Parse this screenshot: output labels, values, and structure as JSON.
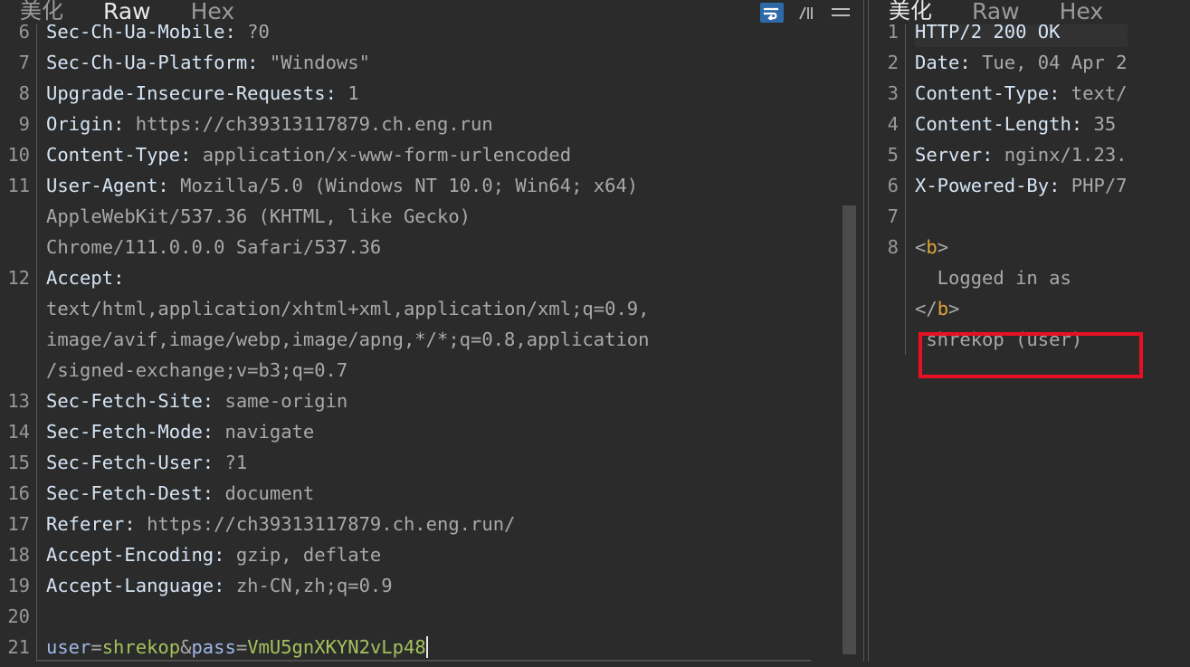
{
  "request_panel": {
    "tabs": [
      {
        "label": "美化",
        "active": false,
        "cjk": true
      },
      {
        "label": "Raw",
        "active": true,
        "cjk": false
      },
      {
        "label": "Hex",
        "active": false,
        "cjk": false
      }
    ],
    "icons": [
      {
        "name": "word-wrap-icon",
        "selected": true
      },
      {
        "name": "newline-escape-icon",
        "selected": false
      },
      {
        "name": "hamburger-menu-icon",
        "selected": false
      }
    ],
    "lines": [
      {
        "num": "6",
        "segments": [
          {
            "t": "Sec-Ch-Ua-Mobile",
            "c": "hdr"
          },
          {
            "t": ": ",
            "c": "hdr"
          },
          {
            "t": "?0",
            "c": "val"
          }
        ],
        "clipped_top": true
      },
      {
        "num": "7",
        "segments": [
          {
            "t": "Sec-Ch-Ua-Platform",
            "c": "hdr"
          },
          {
            "t": ": ",
            "c": "hdr"
          },
          {
            "t": "\"Windows\"",
            "c": "val"
          }
        ]
      },
      {
        "num": "8",
        "segments": [
          {
            "t": "Upgrade-Insecure-Requests",
            "c": "hdr"
          },
          {
            "t": ": ",
            "c": "hdr"
          },
          {
            "t": "1",
            "c": "val"
          }
        ]
      },
      {
        "num": "9",
        "segments": [
          {
            "t": "Origin",
            "c": "hdr"
          },
          {
            "t": ": ",
            "c": "hdr"
          },
          {
            "t": "https://ch39313117879.ch.eng.run",
            "c": "val"
          }
        ]
      },
      {
        "num": "10",
        "segments": [
          {
            "t": "Content-Type",
            "c": "hdr"
          },
          {
            "t": ": ",
            "c": "hdr"
          },
          {
            "t": "application/x-www-form-urlencoded",
            "c": "val"
          }
        ]
      },
      {
        "num": "11",
        "segments": [
          {
            "t": "User-Agent",
            "c": "hdr"
          },
          {
            "t": ": ",
            "c": "hdr"
          },
          {
            "t": "Mozilla/5.0 (Windows NT 10.0; Win64; x64)",
            "c": "val"
          }
        ]
      },
      {
        "num": "",
        "segments": [
          {
            "t": "AppleWebKit/537.36 (KHTML, like Gecko)",
            "c": "val"
          }
        ]
      },
      {
        "num": "",
        "segments": [
          {
            "t": "Chrome/111.0.0.0 Safari/537.36",
            "c": "val"
          }
        ]
      },
      {
        "num": "12",
        "segments": [
          {
            "t": "Accept",
            "c": "hdr"
          },
          {
            "t": ":",
            "c": "hdr"
          }
        ]
      },
      {
        "num": "",
        "segments": [
          {
            "t": "text/html,application/xhtml+xml,application/xml;q=0.9,",
            "c": "val"
          }
        ]
      },
      {
        "num": "",
        "segments": [
          {
            "t": "image/avif,image/webp,image/apng,*/*;q=0.8,application",
            "c": "val"
          }
        ]
      },
      {
        "num": "",
        "segments": [
          {
            "t": "/signed-exchange;v=b3;q=0.7",
            "c": "val"
          }
        ]
      },
      {
        "num": "13",
        "segments": [
          {
            "t": "Sec-Fetch-Site",
            "c": "hdr"
          },
          {
            "t": ": ",
            "c": "hdr"
          },
          {
            "t": "same-origin",
            "c": "val"
          }
        ]
      },
      {
        "num": "14",
        "segments": [
          {
            "t": "Sec-Fetch-Mode",
            "c": "hdr"
          },
          {
            "t": ": ",
            "c": "hdr"
          },
          {
            "t": "navigate",
            "c": "val"
          }
        ]
      },
      {
        "num": "15",
        "segments": [
          {
            "t": "Sec-Fetch-User",
            "c": "hdr"
          },
          {
            "t": ": ",
            "c": "hdr"
          },
          {
            "t": "?1",
            "c": "val"
          }
        ]
      },
      {
        "num": "16",
        "segments": [
          {
            "t": "Sec-Fetch-Dest",
            "c": "hdr"
          },
          {
            "t": ": ",
            "c": "hdr"
          },
          {
            "t": "document",
            "c": "val"
          }
        ]
      },
      {
        "num": "17",
        "segments": [
          {
            "t": "Referer",
            "c": "hdr"
          },
          {
            "t": ": ",
            "c": "hdr"
          },
          {
            "t": "https://ch39313117879.ch.eng.run/",
            "c": "val"
          }
        ]
      },
      {
        "num": "18",
        "segments": [
          {
            "t": "Accept-Encoding",
            "c": "hdr"
          },
          {
            "t": ": ",
            "c": "hdr"
          },
          {
            "t": "gzip, deflate",
            "c": "val"
          }
        ]
      },
      {
        "num": "19",
        "segments": [
          {
            "t": "Accept-Language",
            "c": "hdr"
          },
          {
            "t": ": ",
            "c": "hdr"
          },
          {
            "t": "zh-CN,zh;q=0.9",
            "c": "val"
          }
        ]
      },
      {
        "num": "20",
        "segments": []
      },
      {
        "num": "21",
        "segments": [
          {
            "t": "user",
            "c": "key"
          },
          {
            "t": "=",
            "c": "val"
          },
          {
            "t": "shrekop",
            "c": "str"
          },
          {
            "t": "&",
            "c": "val"
          },
          {
            "t": "pass",
            "c": "key"
          },
          {
            "t": "=",
            "c": "val"
          },
          {
            "t": "VmU5gnXKYN2vLp48",
            "c": "str"
          }
        ],
        "caret": true
      }
    ]
  },
  "response_panel": {
    "tabs": [
      {
        "label": "美化",
        "active": true,
        "cjk": true
      },
      {
        "label": "Raw",
        "active": false,
        "cjk": false
      },
      {
        "label": "Hex",
        "active": false,
        "cjk": false
      }
    ],
    "lines": [
      {
        "num": "1",
        "segments": [
          {
            "t": "HTTP/2 200 OK",
            "c": "hdr"
          }
        ],
        "current": true
      },
      {
        "num": "2",
        "segments": [
          {
            "t": "Date",
            "c": "hdr"
          },
          {
            "t": ": ",
            "c": "hdr"
          },
          {
            "t": "Tue, 04 Apr 2",
            "c": "val"
          }
        ]
      },
      {
        "num": "3",
        "segments": [
          {
            "t": "Content-Type",
            "c": "hdr"
          },
          {
            "t": ": ",
            "c": "hdr"
          },
          {
            "t": "text/",
            "c": "val"
          }
        ]
      },
      {
        "num": "4",
        "segments": [
          {
            "t": "Content-Length",
            "c": "hdr"
          },
          {
            "t": ": ",
            "c": "hdr"
          },
          {
            "t": "35",
            "c": "val"
          }
        ]
      },
      {
        "num": "5",
        "segments": [
          {
            "t": "Server",
            "c": "hdr"
          },
          {
            "t": ": ",
            "c": "hdr"
          },
          {
            "t": "nginx/1.23.",
            "c": "val"
          }
        ]
      },
      {
        "num": "6",
        "segments": [
          {
            "t": "X-Powered-By",
            "c": "hdr"
          },
          {
            "t": ": ",
            "c": "hdr"
          },
          {
            "t": "PHP/7",
            "c": "val"
          }
        ]
      },
      {
        "num": "7",
        "segments": []
      },
      {
        "num": "8",
        "segments": [
          {
            "t": "<",
            "c": "val"
          },
          {
            "t": "b",
            "c": "tag"
          },
          {
            "t": ">",
            "c": "val"
          }
        ]
      },
      {
        "num": "",
        "segments": [
          {
            "t": "  Logged in as",
            "c": "val"
          }
        ]
      },
      {
        "num": "",
        "segments": [
          {
            "t": "</",
            "c": "val"
          },
          {
            "t": "b",
            "c": "tag"
          },
          {
            "t": ">",
            "c": "val"
          }
        ]
      },
      {
        "num": "",
        "segments": [
          {
            "t": " shrekop (user)",
            "c": "val"
          }
        ]
      }
    ],
    "annotation": {
      "name": "red-highlight-box",
      "label": "shrekop (user)"
    }
  },
  "colors": {
    "accent_underline": "#d9691a",
    "annotation_red": "#e81123",
    "selected_icon_blue": "#2f6aa8",
    "background": "#2b2b2b",
    "header_name": "#d5e5f5",
    "header_value": "#a9a9a9",
    "param_key": "#9fb8e8",
    "param_value": "#a5c25c",
    "html_tag": "#e0a33a"
  }
}
